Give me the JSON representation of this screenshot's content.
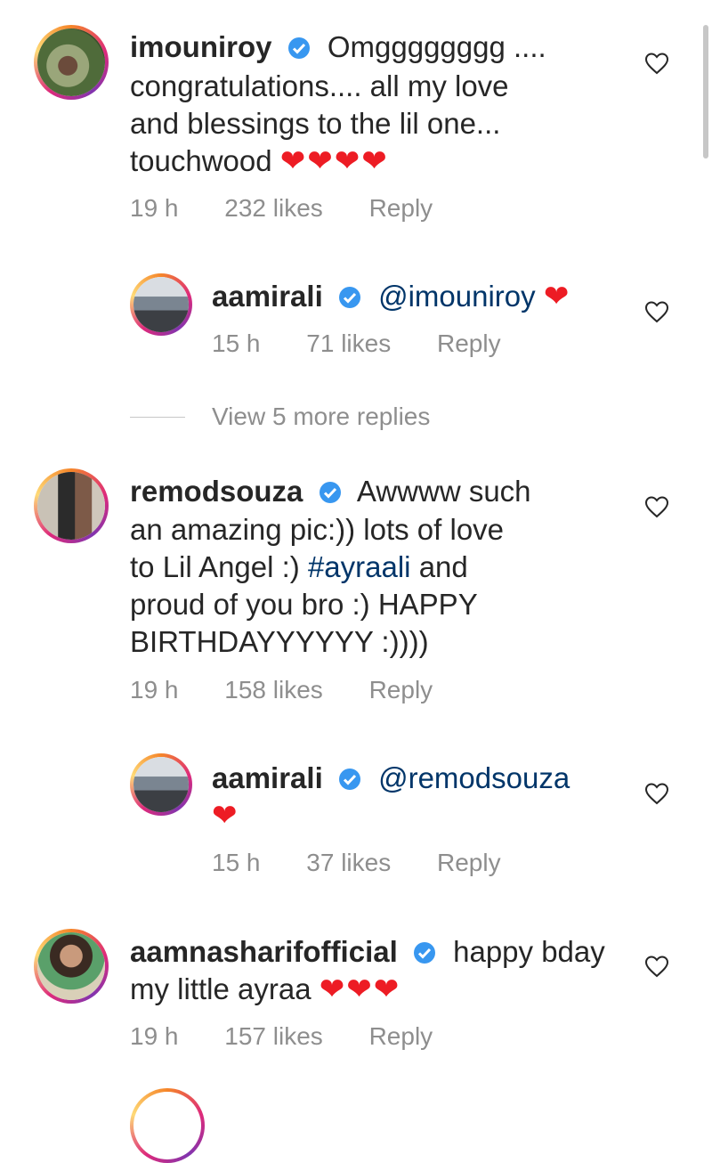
{
  "comments": [
    {
      "username": "imouniroy",
      "text": "Omgggggggg ....",
      "text_lines": [
        "congratulations.... all my love",
        "and blessings to the lil one...",
        "touchwood"
      ],
      "emoji": "❤❤❤❤",
      "time": "19 h",
      "likes": "232 likes",
      "reply": "Reply"
    },
    {
      "username": "aamirali",
      "mention": "@imouniroy",
      "emoji": "❤",
      "time": "15 h",
      "likes": "71 likes",
      "reply": "Reply"
    },
    {
      "username": "remodsouza",
      "text": "Awwww such",
      "text_lines": [
        "an amazing pic:)) lots of love",
        "to Lil Angel :) ",
        "proud of you bro :) HAPPY",
        "BIRTHDAYYYYYY :))))"
      ],
      "hashtag": "#ayraali",
      "after_hashtag": " and",
      "time": "19 h",
      "likes": "158 likes",
      "reply": "Reply"
    },
    {
      "username": "aamirali",
      "mention": "@remodsouza",
      "emoji": "❤",
      "time": "15 h",
      "likes": "37 likes",
      "reply": "Reply"
    },
    {
      "username": "aamnasharifofficial",
      "text": "happy bday",
      "text_lines": [
        "my little ayraa"
      ],
      "emoji": "❤❤❤",
      "time": "19 h",
      "likes": "157 likes",
      "reply": "Reply"
    }
  ],
  "view_more": "View 5 more replies",
  "colors": {
    "link": "#003569",
    "verified": "#3897f0",
    "meta": "#8e8e8e",
    "heart": "#ed1c24"
  }
}
